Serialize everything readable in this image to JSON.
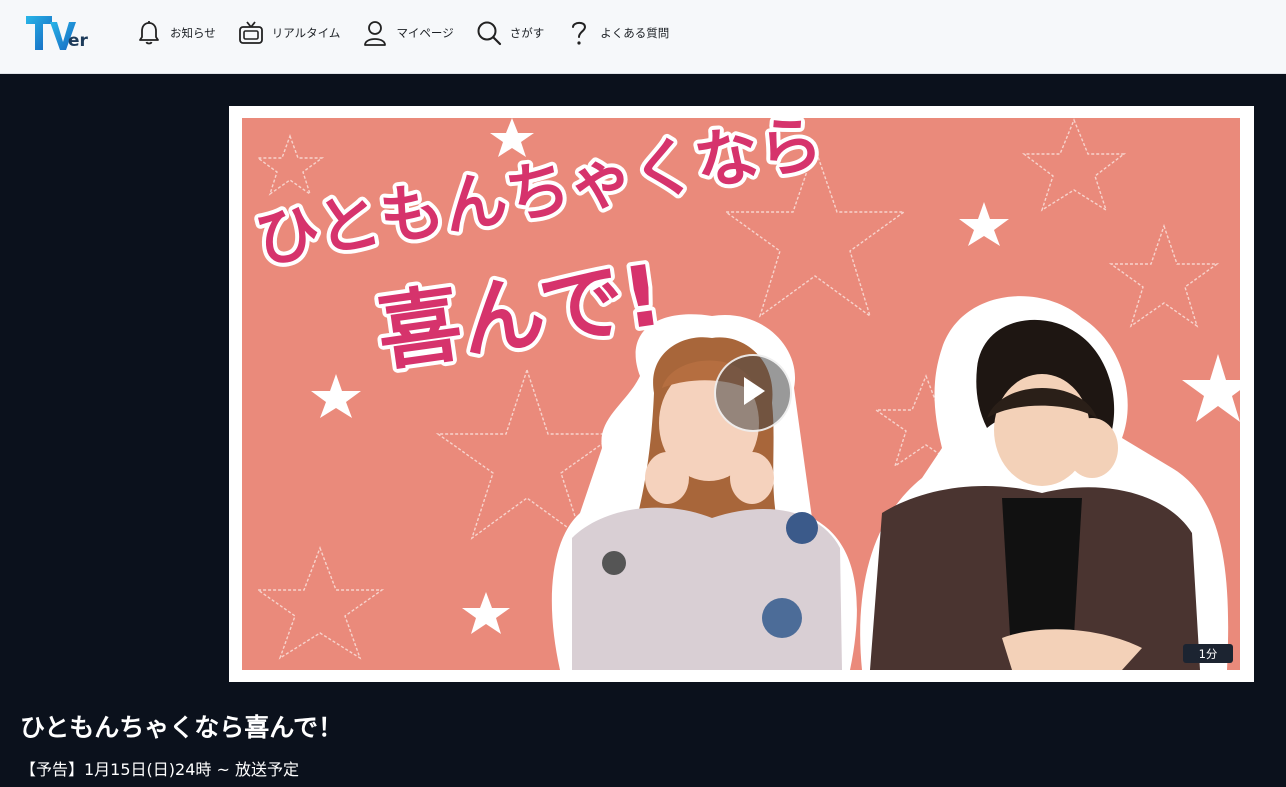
{
  "header": {
    "logo_text": "TVer",
    "nav": [
      {
        "label": "お知らせ",
        "icon": "bell-icon"
      },
      {
        "label": "リアルタイム",
        "icon": "tv-icon"
      },
      {
        "label": "マイページ",
        "icon": "user-icon"
      },
      {
        "label": "さがす",
        "icon": "search-icon"
      },
      {
        "label": "よくある質問",
        "icon": "help-icon"
      }
    ]
  },
  "player": {
    "thumbnail_title_line1": "ひともんちゃくなら",
    "thumbnail_title_line2": "喜んで!",
    "duration_badge": "1分",
    "play_icon": "play-icon"
  },
  "episode": {
    "title": "ひともんちゃくなら喜んで！",
    "subtitle": "【予告】1月15日(日)24時 ~ 放送予定"
  },
  "colors": {
    "page_bg": "#0b111c",
    "header_bg": "#f6f8fa",
    "thumb_bg": "#ea8a7b",
    "title_pink": "#d6336c",
    "title_teal": "#1aa0b4"
  }
}
